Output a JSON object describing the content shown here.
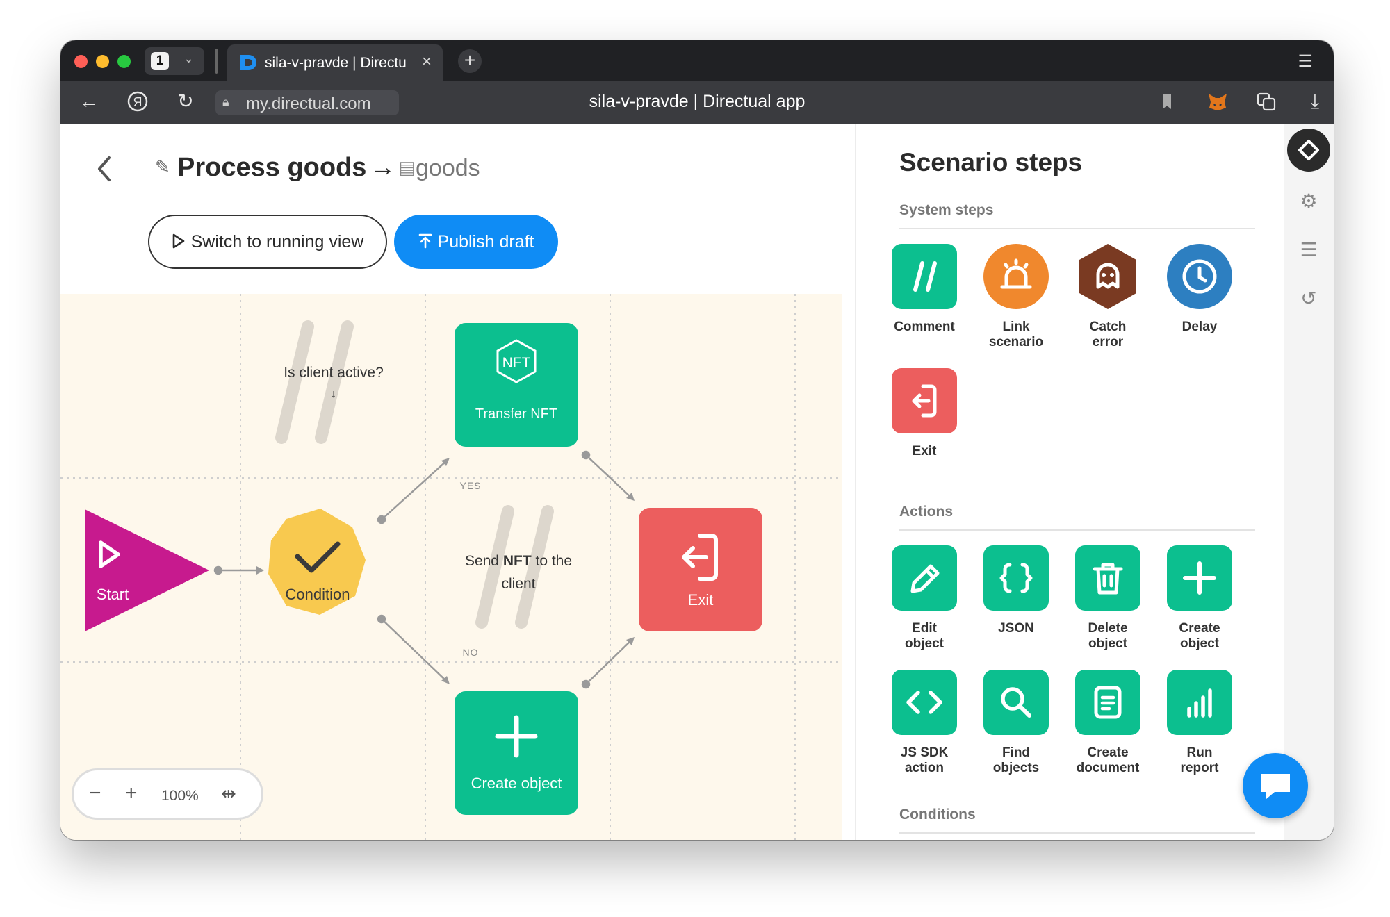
{
  "browser": {
    "tab_count": "1",
    "tab_title": "sila-v-pravde | Directual app",
    "tab_title_short": "sila-v-pravde | Directu",
    "url": "my.directual.com",
    "page_title": "sila-v-pravde | Directual app"
  },
  "editor": {
    "title": "Process goods",
    "arrow": "→",
    "collection": "goods",
    "switch_label": "Switch to running view",
    "publish_label": "Publish draft",
    "zoom": "100%"
  },
  "canvas": {
    "start_label": "Start",
    "condition_label": "Condition",
    "transfer_label": "Transfer NFT",
    "exit_label": "Exit",
    "create_label": "Create object",
    "yes_label": "YES",
    "no_label": "NO",
    "comment1": "Is client active?",
    "comment1_arrow": "↓",
    "comment2_a": "Send ",
    "comment2_b": "NFT",
    "comment2_c": " to the",
    "comment2_d": "client",
    "colors": {
      "start": "#c71a8e",
      "condition": "#f8c94f",
      "action": "#0cbf8f",
      "exit": "#ec5e5e",
      "background": "#fef8ec"
    }
  },
  "sidebar": {
    "title": "Scenario steps",
    "system_title": "System steps",
    "actions_title": "Actions",
    "conditions_title": "Conditions",
    "system_steps": [
      {
        "l1": "Comment",
        "l2": "",
        "color": "#0cbf8f",
        "icon": "comment-icon"
      },
      {
        "l1": "Link",
        "l2": "scenario",
        "color": "#f0882d",
        "icon": "link-scenario-icon"
      },
      {
        "l1": "Catch",
        "l2": "error",
        "color": "#7a3a22",
        "icon": "ghost-icon"
      },
      {
        "l1": "Delay",
        "l2": "",
        "color": "#2d7fc1",
        "icon": "clock-icon"
      },
      {
        "l1": "Exit",
        "l2": "",
        "color": "#ec5e5e",
        "icon": "exit-icon"
      }
    ],
    "actions": [
      {
        "l1": "Edit",
        "l2": "object",
        "icon": "pencil-icon"
      },
      {
        "l1": "JSON",
        "l2": "",
        "icon": "braces-icon"
      },
      {
        "l1": "Delete",
        "l2": "object",
        "icon": "trash-icon"
      },
      {
        "l1": "Create",
        "l2": "object",
        "icon": "plus-icon"
      },
      {
        "l1": "JS SDK",
        "l2": "action",
        "icon": "code-icon"
      },
      {
        "l1": "Find",
        "l2": "objects",
        "icon": "search-icon"
      },
      {
        "l1": "Create",
        "l2": "document",
        "icon": "document-icon"
      },
      {
        "l1": "Run",
        "l2": "report",
        "icon": "chart-icon"
      }
    ]
  }
}
